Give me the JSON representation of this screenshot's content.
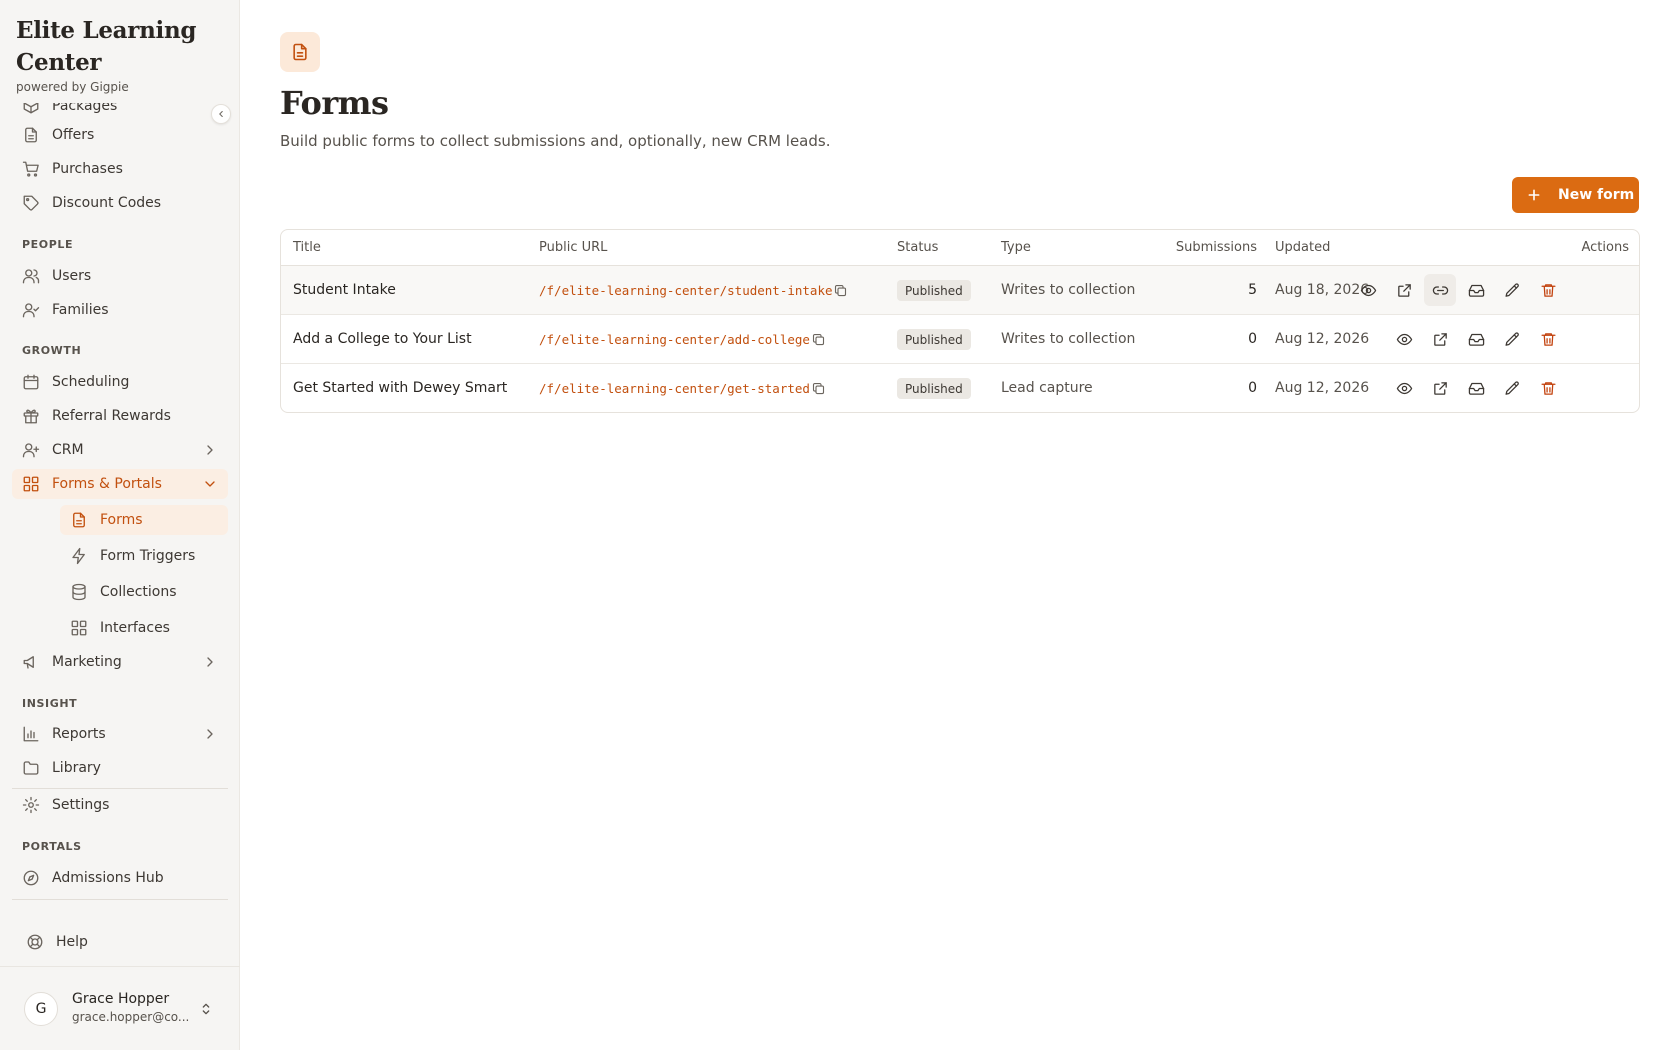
{
  "brand": {
    "title": "Elite Learning Center",
    "subtitle": "powered by Gigpie"
  },
  "nav": {
    "packages": "Packages",
    "offers": "Offers",
    "purchases": "Purchases",
    "discount_codes": "Discount Codes",
    "people_label": "PEOPLE",
    "users": "Users",
    "families": "Families",
    "growth_label": "GROWTH",
    "scheduling": "Scheduling",
    "referral_rewards": "Referral Rewards",
    "crm": "CRM",
    "forms_portals": "Forms & Portals",
    "forms": "Forms",
    "form_triggers": "Form Triggers",
    "collections": "Collections",
    "interfaces": "Interfaces",
    "marketing": "Marketing",
    "insight_label": "INSIGHT",
    "reports": "Reports",
    "library": "Library",
    "settings": "Settings",
    "portals_label": "PORTALS",
    "admissions_hub": "Admissions Hub",
    "help": "Help"
  },
  "user": {
    "initial": "G",
    "name": "Grace Hopper",
    "email": "grace.hopper@co..."
  },
  "page": {
    "icon": "document-icon",
    "title": "Forms",
    "description": "Build public forms to collect submissions and, optionally, new CRM leads.",
    "new_button": "New form"
  },
  "table": {
    "headers": {
      "title": "Title",
      "url": "Public URL",
      "status": "Status",
      "type": "Type",
      "submissions": "Submissions",
      "updated": "Updated",
      "actions": "Actions"
    },
    "rows": [
      {
        "title": "Student Intake",
        "url": "/f/elite-learning-center/student-intake",
        "status": "Published",
        "type": "Writes to collection",
        "submissions": "5",
        "updated": "Aug 18, 2026",
        "actions": [
          "view",
          "open",
          "link",
          "inbox",
          "edit",
          "delete"
        ]
      },
      {
        "title": "Add a College to Your List",
        "url": "/f/elite-learning-center/add-college",
        "status": "Published",
        "type": "Writes to collection",
        "submissions": "0",
        "updated": "Aug 12, 2026",
        "actions": [
          "view",
          "open",
          "inbox",
          "edit",
          "delete"
        ]
      },
      {
        "title": "Get Started with Dewey Smart",
        "url": "/f/elite-learning-center/get-started",
        "status": "Published",
        "type": "Lead capture",
        "submissions": "0",
        "updated": "Aug 12, 2026",
        "actions": [
          "view",
          "open",
          "inbox",
          "edit",
          "delete"
        ]
      }
    ]
  },
  "colors": {
    "accent": "#db6b12",
    "accent_text": "#c2500f",
    "delete": "#c2410c"
  }
}
